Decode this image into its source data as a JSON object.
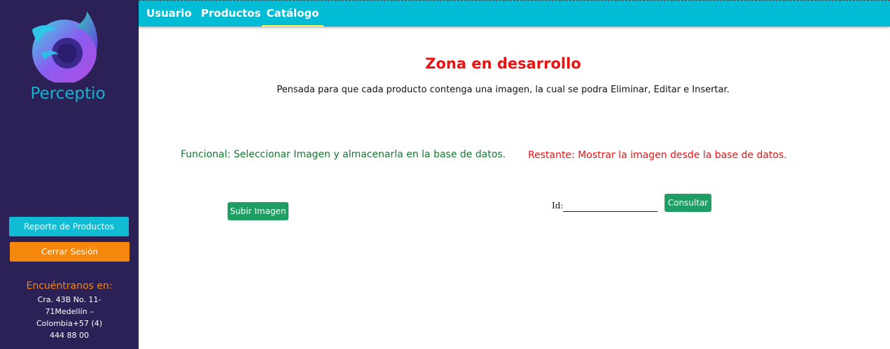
{
  "sidebar": {
    "brand": "Perceptio",
    "report_button": "Reporte de Productos",
    "logout_button": "Cerrar Sesión",
    "contact_title": "Encuéntranos en:",
    "contact_address": "Cra. 43B No. 11-71Medellín – Colombia+57 (4) 444 88 00"
  },
  "nav": {
    "tabs": [
      "Usuario",
      "Productos",
      "Catálogo"
    ],
    "active_tab": "Catálogo"
  },
  "main": {
    "heading": "Zona en desarrollo",
    "subtitle": "Pensada para que cada producto contenga una imagen, la cual se podra Eliminar, Editar e Insertar.",
    "functional_text": "Funcional: Seleccionar Imagen y almacenarla en la base de datos.",
    "remaining_text": "Restante: Mostrar la imagen desde la base de datos.",
    "upload_button": "Subir Imagen",
    "id_label": "Id:",
    "id_value": "",
    "query_button": "Consultar"
  },
  "colors": {
    "sidebar_bg": "#2b2157",
    "nav_bg": "#00bcd4",
    "brand": "#12b4cf",
    "accent_orange": "#f5870c",
    "accent_green": "#1e9e63",
    "alert_red": "#ee1111",
    "success_green": "#157a2e",
    "active_tab_underline": "#f7f35a"
  }
}
